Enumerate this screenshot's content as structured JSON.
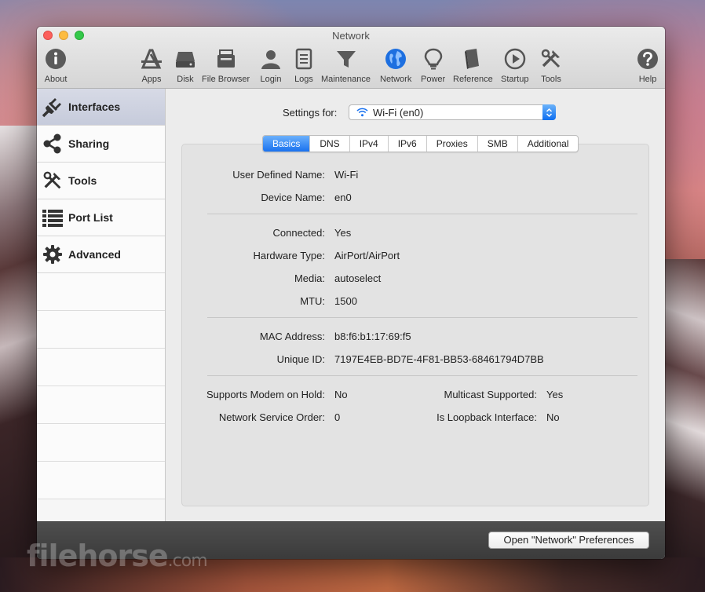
{
  "window": {
    "title": "Network"
  },
  "toolbar": {
    "items": [
      {
        "label": "About",
        "icon": "info-icon"
      },
      {
        "label": "Apps",
        "icon": "apps-icon"
      },
      {
        "label": "Disk",
        "icon": "disk-icon"
      },
      {
        "label": "File Browser",
        "icon": "file-browser-icon"
      },
      {
        "label": "Login",
        "icon": "user-icon"
      },
      {
        "label": "Logs",
        "icon": "logs-icon"
      },
      {
        "label": "Maintenance",
        "icon": "funnel-icon"
      },
      {
        "label": "Network",
        "icon": "globe-icon"
      },
      {
        "label": "Power",
        "icon": "lightbulb-icon"
      },
      {
        "label": "Reference",
        "icon": "book-icon"
      },
      {
        "label": "Startup",
        "icon": "play-icon"
      },
      {
        "label": "Tools",
        "icon": "tools-icon"
      },
      {
        "label": "Help",
        "icon": "help-icon"
      }
    ]
  },
  "sidebar": {
    "items": [
      {
        "label": "Interfaces",
        "icon": "plug-icon",
        "selected": true
      },
      {
        "label": "Sharing",
        "icon": "share-icon"
      },
      {
        "label": "Tools",
        "icon": "tools-icon"
      },
      {
        "label": "Port List",
        "icon": "list-icon"
      },
      {
        "label": "Advanced",
        "icon": "gear-icon"
      }
    ]
  },
  "settings": {
    "label": "Settings for:",
    "selected": "Wi-Fi (en0)"
  },
  "tabs": [
    "Basics",
    "DNS",
    "IPv4",
    "IPv6",
    "Proxies",
    "SMB",
    "Additional"
  ],
  "active_tab": "Basics",
  "basics": {
    "user_defined_name": {
      "label": "User Defined Name:",
      "value": "Wi-Fi"
    },
    "device_name": {
      "label": "Device Name:",
      "value": "en0"
    },
    "connected": {
      "label": "Connected:",
      "value": "Yes"
    },
    "hardware_type": {
      "label": "Hardware Type:",
      "value": "AirPort/AirPort"
    },
    "media": {
      "label": "Media:",
      "value": "autoselect"
    },
    "mtu": {
      "label": "MTU:",
      "value": "1500"
    },
    "mac_address": {
      "label": "MAC Address:",
      "value": "b8:f6:b1:17:69:f5"
    },
    "unique_id": {
      "label": "Unique ID:",
      "value": "7197E4EB-BD7E-4F81-BB53-68461794D7BB"
    },
    "modem_on_hold": {
      "label": "Supports Modem on Hold:",
      "value": "No"
    },
    "service_order": {
      "label": "Network Service Order:",
      "value": "0"
    },
    "multicast": {
      "label": "Multicast Supported:",
      "value": "Yes"
    },
    "loopback": {
      "label": "Is Loopback Interface:",
      "value": "No"
    }
  },
  "footer": {
    "open_button": "Open \"Network\" Preferences"
  },
  "watermark": {
    "brand": "filehorse",
    "suffix": ".com"
  },
  "colors": {
    "accent": "#1a72ef",
    "selected_sidebar": "#c6cbdb"
  }
}
